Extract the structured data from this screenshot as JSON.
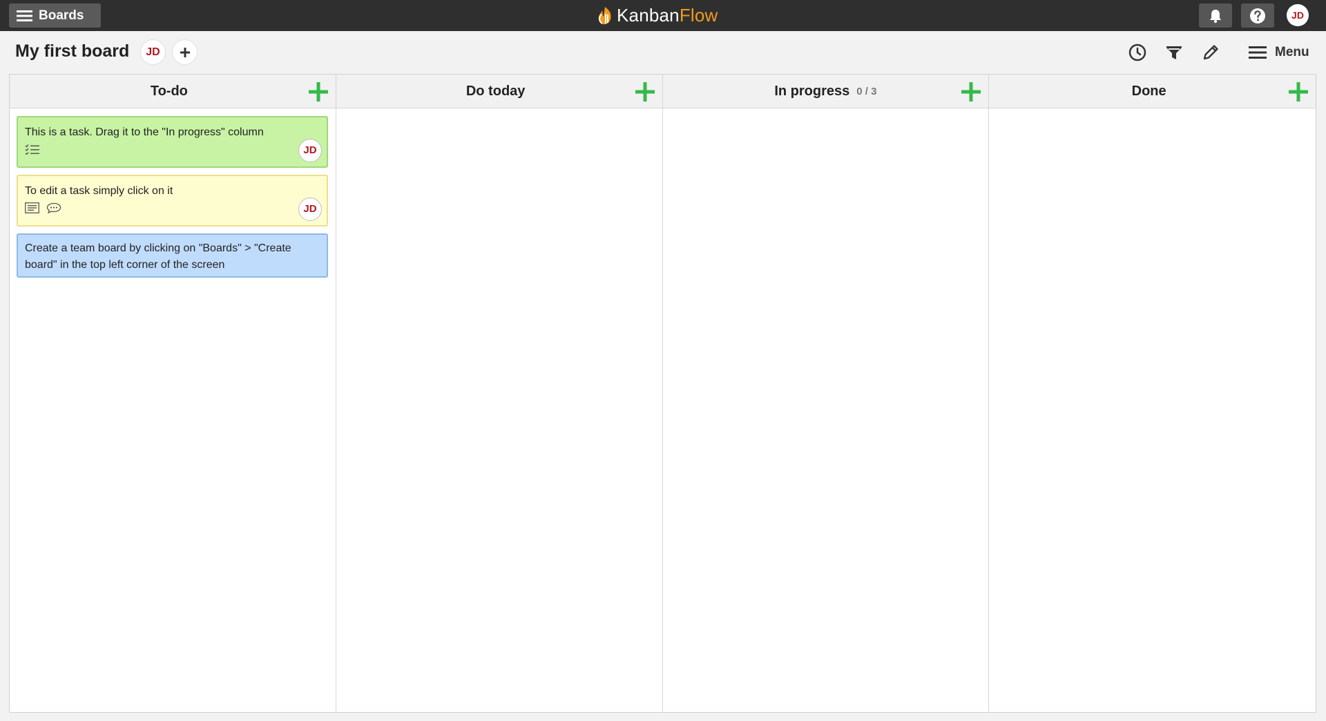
{
  "topbar": {
    "boards_label": "Boards",
    "logo_part1": "Kanban",
    "logo_part2": "Flow",
    "user_initials": "JD"
  },
  "board": {
    "title": "My first board",
    "member_initials": "JD",
    "menu_label": "Menu"
  },
  "columns": [
    {
      "name": "To-do",
      "wip": ""
    },
    {
      "name": "Do today",
      "wip": ""
    },
    {
      "name": "In progress",
      "wip": "0 / 3"
    },
    {
      "name": "Done",
      "wip": ""
    }
  ],
  "tasks": [
    {
      "text": "This is a task. Drag it to the \"In progress\" column",
      "color": "green",
      "assignee": "JD",
      "icons": [
        "subtasks-icon"
      ]
    },
    {
      "text": "To edit a task simply click on it",
      "color": "yellow",
      "assignee": "JD",
      "icons": [
        "description-icon",
        "comment-icon"
      ]
    },
    {
      "text": "Create a team board by clicking on \"Boards\" > \"Create board\" in the top left corner of the screen",
      "color": "blue",
      "assignee": "",
      "icons": []
    }
  ],
  "colors": {
    "topbar": "#2f2f2f",
    "accent_green": "#35b94a",
    "logo_orange": "#f29a1e",
    "avatar_red": "#b0171f"
  }
}
